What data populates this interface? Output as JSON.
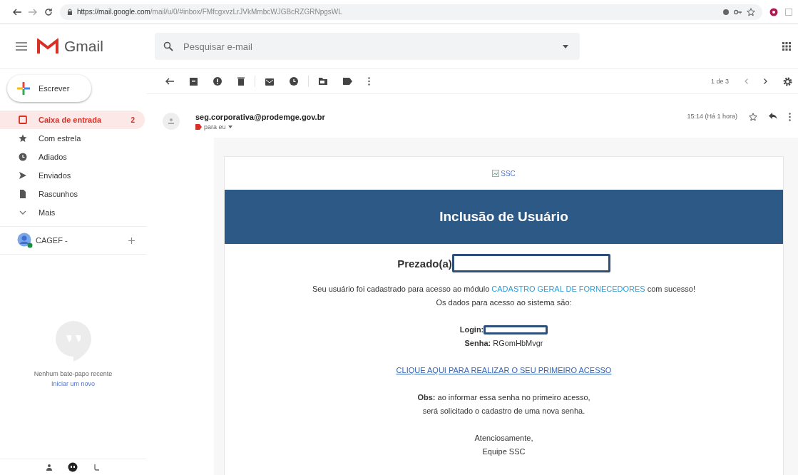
{
  "browser": {
    "url_host": "https://mail.google.com",
    "url_path": "/mail/u/0/#inbox/FMfcgxvzLrJVkMmbcWJGBcRZGRNpgsWL"
  },
  "app": {
    "name": "Gmail",
    "search_placeholder": "Pesquisar e-mail"
  },
  "compose": {
    "label": "Escrever"
  },
  "sidebar": {
    "items": [
      {
        "kind": "inbox",
        "label": "Caixa de entrada",
        "count": "2",
        "selected": true
      },
      {
        "kind": "star",
        "label": "Com estrela",
        "selected": false
      },
      {
        "kind": "clock",
        "label": "Adiados",
        "selected": false
      },
      {
        "kind": "send",
        "label": "Enviados",
        "selected": false
      },
      {
        "kind": "draft",
        "label": "Rascunhos",
        "selected": false
      },
      {
        "kind": "more",
        "label": "Mais",
        "selected": false
      }
    ],
    "account": "CAGEF -",
    "chat_empty": "Nenhum bate-papo recente",
    "chat_link": "Iniciar um novo"
  },
  "toolbar": {
    "pager": "1 de 3"
  },
  "message": {
    "sender": "seg.corporativa@prodemge.gov.br",
    "recipient": "para eu",
    "time": "15:14 (Há 1 hora)"
  },
  "email": {
    "image_alt": "SSC",
    "banner": "Inclusão de Usuário",
    "greeting": "Prezado(a)",
    "intro_before": "Seu usuário foi cadastrado para acesso ao módulo ",
    "intro_link": "CADASTRO GERAL DE FORNECEDORES",
    "intro_after": " com sucesso!",
    "intro_2": "Os dados para acesso ao sistema são:",
    "login_label": "Login:",
    "password": "**Senha:** RGomHbMvgr",
    "access_link": "CLIQUE AQUI PARA REALIZAR O SEU PRIMEIRO ACESSO",
    "note_1": "**Obs:** ao informar essa senha no primeiro acesso,",
    "note_2": "será solicitado o cadastro de uma nova senha.",
    "closing": "Atenciosamente,",
    "signature": "Equipe SSC"
  }
}
